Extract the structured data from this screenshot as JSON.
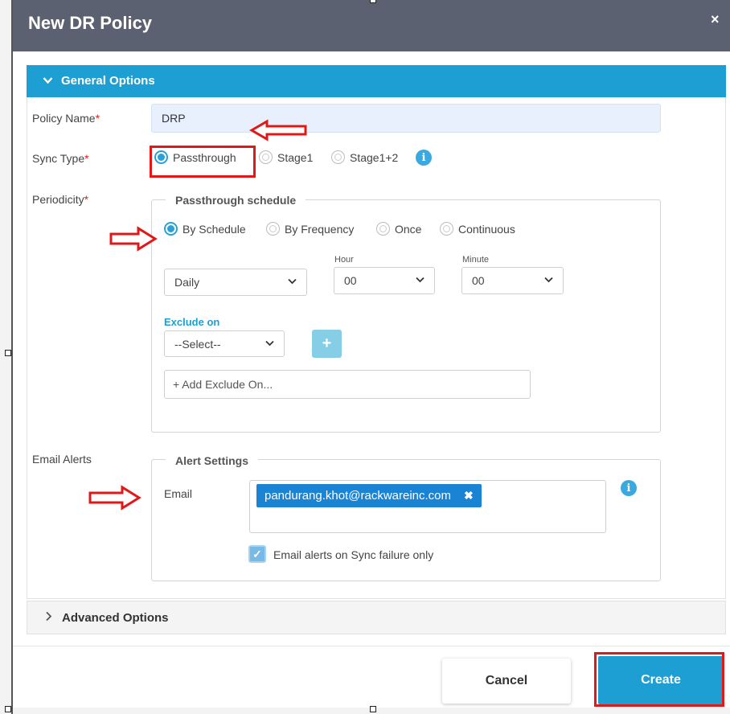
{
  "dialog": {
    "title": "New DR Policy",
    "close_glyph": "×"
  },
  "general": {
    "header": "General Options",
    "policy_name": {
      "label": "Policy Name",
      "required": "*",
      "value": "DRP"
    },
    "sync_type": {
      "label": "Sync Type",
      "required": "*",
      "options": [
        "Passthrough",
        "Stage1",
        "Stage1+2"
      ],
      "selected": "Passthrough"
    },
    "periodicity": {
      "label": "Periodicity",
      "required": "*",
      "legend": "Passthrough schedule",
      "options": [
        "By Schedule",
        "By Frequency",
        "Once",
        "Continuous"
      ],
      "selected": "By Schedule",
      "frequency": "Daily",
      "hour_label": "Hour",
      "hour": "00",
      "minute_label": "Minute",
      "minute": "00",
      "exclude_label": "Exclude on",
      "exclude_select": "--Select--",
      "add_exclude_placeholder": "+ Add Exclude On..."
    },
    "email_alerts": {
      "label": "Email Alerts",
      "legend": "Alert Settings",
      "email_label": "Email",
      "emails": [
        "pandurang.khot@rackwareinc.com"
      ],
      "sync_failure_only_label": "Email alerts on Sync failure only",
      "sync_failure_only": true
    }
  },
  "advanced": {
    "header": "Advanced Options"
  },
  "footer": {
    "cancel": "Cancel",
    "create": "Create"
  },
  "icons": {
    "info": "i",
    "checkmark": "✓",
    "remove": "✖",
    "chevron_down": "⌄",
    "chevron_right": "›",
    "select_caret": "⌄"
  },
  "colors": {
    "title_bar": "#5b6170",
    "accent": "#1e9fd3",
    "annotation": "#e01818",
    "chip": "#1a83d4"
  }
}
